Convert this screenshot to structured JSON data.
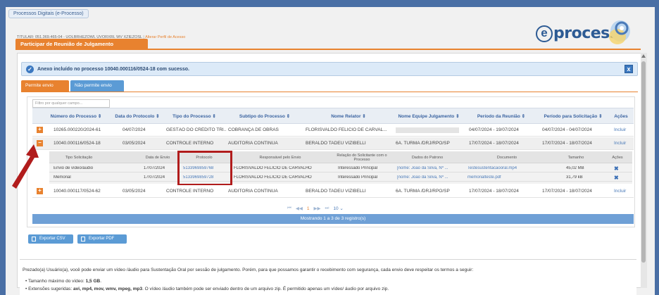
{
  "app": {
    "title": "Processos Digitais (e-Processo)",
    "user_line": "TITULAR: 051.369.465-04 - UOLBRHEZOWL UVORXRL WV XZIEZOSL",
    "user_separator": "|",
    "change_profile_link": "Alterar Perfil de Acesso",
    "logo_e": "e",
    "logo_text": "processo"
  },
  "section": {
    "title": "Participar de Reunião de Julgamento"
  },
  "alert": {
    "message": "Anexo incluído no processo 10040.000116/0524-18 com sucesso.",
    "close_label": "x"
  },
  "tabs": [
    {
      "label": "Permite envio",
      "active": true
    },
    {
      "label": "Não permite envio",
      "active": false
    }
  ],
  "filter": {
    "placeholder": "Filtro por qualquer campo..."
  },
  "table": {
    "headers": [
      "Número do Processo ⇕",
      "Data do Protocolo ⇕",
      "Tipo do Processo ⇕",
      "Subtipo do Processo ⇕",
      "Nome Relator ⇕",
      "Nome Equipe Julgamento ⇕",
      "Período da Reunião ⇕",
      "Período para Solicitação ⇕",
      "Ações"
    ],
    "rows": [
      {
        "expander": "+",
        "numero": "10265.000220/2024-61",
        "data": "04/07/2024",
        "tipo": "GESTÃO DO CRÉDITO TRI...",
        "subtipo": "COBRANÇA DE OBRAS",
        "relator": "FLORISVALDO FELICIO DE CARVAL...",
        "equipe": "",
        "reuniao": "04/07/2024 - 19/07/2024",
        "solicitacao": "04/07/2024 - 04/07/2024",
        "acao": "Incluir"
      },
      {
        "expander": "−",
        "numero": "10040.000116/0524-18",
        "data": "03/05/2024",
        "tipo": "CONTROLE INTERNO",
        "subtipo": "AUDITORIA CONTÍNUA",
        "relator": "BERALDO TADEU VIZIBELLI",
        "equipe": "6A. TURMA /DRJ/RPO/SP",
        "reuniao": "17/07/2024 - 18/07/2024",
        "solicitacao": "17/07/2024 - 18/07/2024",
        "acao": "Incluir"
      },
      {
        "expander": "+",
        "numero": "10040.000117/0524-62",
        "data": "03/05/2024",
        "tipo": "CONTROLE INTERNO",
        "subtipo": "AUDITORIA CONTÍNUA",
        "relator": "BERALDO TADEU VIZIBELLI",
        "equipe": "6A. TURMA /DRJ/RPO/SP",
        "reuniao": "17/07/2024 - 18/07/2024",
        "solicitacao": "17/07/2024 - 18/07/2024",
        "acao": "Incluir"
      }
    ]
  },
  "subtable": {
    "headers": [
      "Tipo Solicitação",
      "Data de Envio",
      "Protocolo",
      "Responsável pelo Envio",
      "Relação do Solicitante com o Processo",
      "Dados do Patrono",
      "Documento",
      "Tamanho",
      "Ações"
    ],
    "rows": [
      {
        "tipo": "Envio de vídeo/áudio",
        "data": "17/07/2024",
        "protocolo": "5133969859768",
        "responsavel": "FLORISVALDO FELICIO DE CARVALHO",
        "relacao": "Interessado Principal",
        "patrono": "[nome: João da Silva, Nº ...",
        "documento": "Testesustentacaooral.mp4",
        "tamanho": "45,02 MB",
        "acao": "✖"
      },
      {
        "tipo": "Memorial",
        "data": "17/07/2024",
        "protocolo": "5133969859728",
        "responsavel": "FLORISVALDO FELICIO DE CARVALHO",
        "relacao": "Interessado Principal",
        "patrono": "[nome: João da Silva, Nº ...",
        "documento": "memorialteste.pdf",
        "tamanho": "31,79 kB",
        "acao": "✖"
      }
    ]
  },
  "pager": {
    "first": "⏮",
    "prev": "◀◀",
    "current": "1",
    "next": "▶▶",
    "last": "⏭",
    "page_size": "10 ⌄"
  },
  "showing": "Mostrando 1 a 3 de 3 registro(s)",
  "export": {
    "csv": "Exportar CSV",
    "pdf": "Exportar PDF"
  },
  "info": {
    "paragraph": "Prezado(a) Usuário(a), você pode enviar um vídeo /áudio para Sustentação Oral por sessão de julgamento. Porém, para que possamos garantir o recebimento com segurança, cada envio deve respeitar os termos a seguir:",
    "bullet1_prefix": "Tamanho máximo do vídeo: ",
    "bullet1_value": "1,5 GB",
    "bullet1_suffix": ".",
    "bullet2_prefix": "Extensões sugeridas: ",
    "bullet2_value": "avi, mp4, mov, wmv, mpeg, mp3",
    "bullet2_suffix": ". O vídeo /áudio também pode ser enviado dentro de um arquivo zip. É permitido apenas um vídeo/ áudio por arquivo zip."
  },
  "colors": {
    "accent": "#e8822f",
    "blue": "#5b9bd5",
    "highlight": "#b11c1c"
  }
}
